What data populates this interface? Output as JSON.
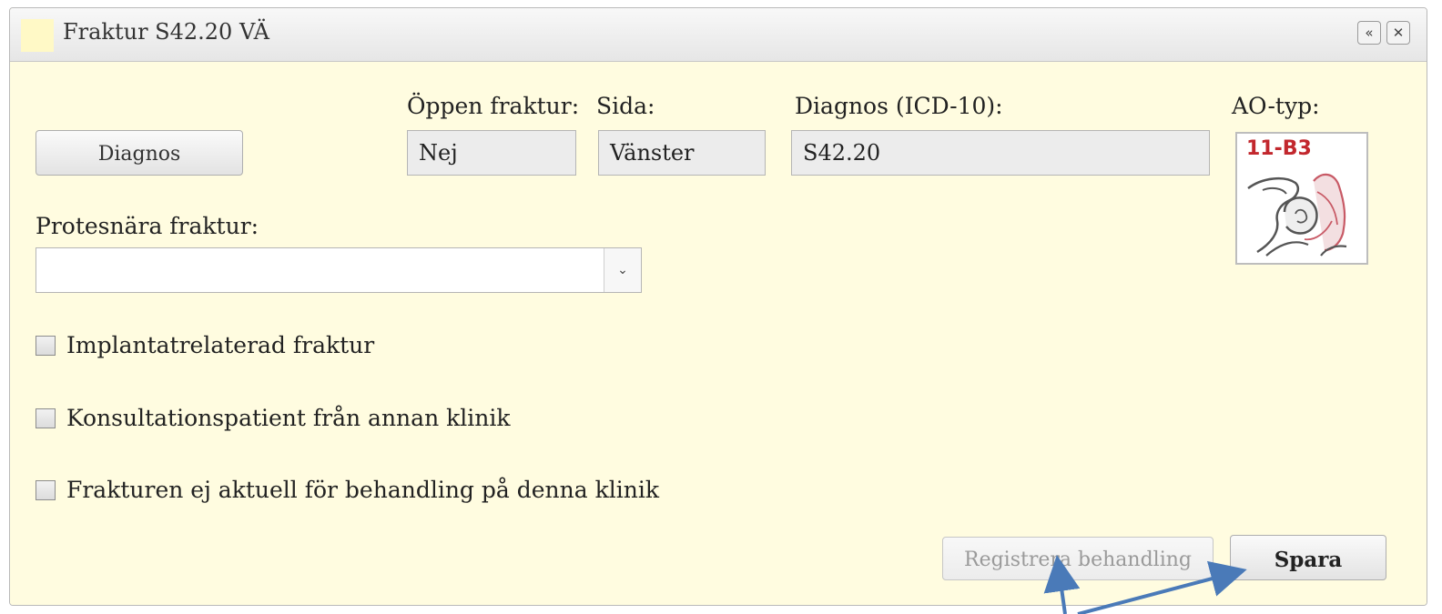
{
  "dialog": {
    "title": "Fraktur S42.20 VÄ",
    "collapse_icon": "double-chevron-up-icon",
    "collapse_glyph": "«",
    "close_icon": "close-icon",
    "close_glyph": "✕"
  },
  "form": {
    "diagnos_button": "Diagnos",
    "open_fracture": {
      "label": "Öppen fraktur:",
      "value": "Nej"
    },
    "side": {
      "label": "Sida:",
      "value": "Vänster"
    },
    "diagnosis_icd10": {
      "label": "Diagnos (ICD-10):",
      "value": "S42.20"
    },
    "ao_type": {
      "label": "AO-typ:",
      "code": "11-B3",
      "code_color": "#c2272d"
    },
    "prosthesis_fracture": {
      "label": "Protesnära fraktur:",
      "value": "",
      "arrow_icon": "chevron-down-icon",
      "arrow_glyph": "⌄"
    },
    "checkboxes": [
      {
        "label": "Implantatrelaterad fraktur",
        "checked": false
      },
      {
        "label": "Konsultationspatient från annan klinik",
        "checked": false
      },
      {
        "label": "Frakturen ej aktuell för behandling på denna klinik",
        "checked": false
      }
    ]
  },
  "actions": {
    "register_treatment": {
      "label": "Registrera behandling",
      "enabled": false
    },
    "save": {
      "label": "Spara"
    }
  },
  "colors": {
    "panel_background": "#fffce0",
    "annotation_arrow": "#4a7ab8"
  }
}
